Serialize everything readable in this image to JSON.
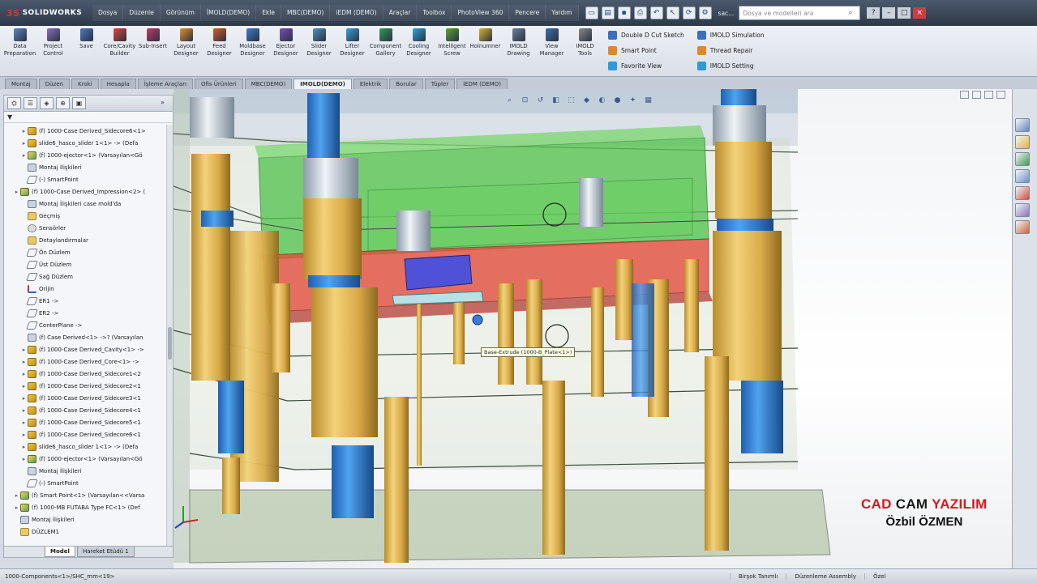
{
  "app": {
    "logo_text": "SOLIDWORKS",
    "menu": [
      "Dosya",
      "Düzenle",
      "Görünüm",
      "İMOLD(DEMO)",
      "Ekle",
      "MBC(DEMO)",
      "iEDM (DEMO)",
      "Araçlar",
      "Toolbox",
      "PhotoView 360",
      "Pencere",
      "Yardım"
    ],
    "quick_icons": [
      "new-icon",
      "open-icon",
      "save-icon",
      "print-icon",
      "undo-icon",
      "select-icon",
      "rebuild-icon",
      "options-icon"
    ],
    "search_placeholder": "Dosya ve modelleri ara",
    "window_title_fragment": "sac..."
  },
  "ribbon": {
    "buttons": [
      {
        "label": "Data\nPreparation",
        "color": "#5b86c9"
      },
      {
        "label": "Project\nControl",
        "color": "#8a6fc0"
      },
      {
        "label": "Save",
        "color": "#4a78c2"
      },
      {
        "label": "Core/Cavity\nBuilder",
        "color": "#d9463b"
      },
      {
        "label": "Sub-Insert",
        "color": "#c03b6a"
      },
      {
        "label": "Layout\nDesigner",
        "color": "#e0922b"
      },
      {
        "label": "Feed\nDesigner",
        "color": "#d45a2a"
      },
      {
        "label": "Moldbase\nDesigner",
        "color": "#3a7fc9"
      },
      {
        "label": "Ejector\nDesigner",
        "color": "#7a4fb8"
      },
      {
        "label": "Slider\nDesigner",
        "color": "#4a90c2"
      },
      {
        "label": "Lifter\nDesigner",
        "color": "#3aa0d9"
      },
      {
        "label": "Component\nGallery",
        "color": "#2f9a5a"
      },
      {
        "label": "Cooling\nDesigner",
        "color": "#2fa3d6"
      },
      {
        "label": "Intelligent\nScrew",
        "color": "#58a43a"
      },
      {
        "label": "Holnumner",
        "color": "#d9b22c"
      },
      {
        "label": "IMOLD\nDrawing",
        "color": "#6a7f98"
      },
      {
        "label": "View\nManager",
        "color": "#3a6fae"
      },
      {
        "label": "IMOLD\nTools",
        "color": "#8a8a8a"
      }
    ],
    "right_col1": [
      "Double D Cut Sketch",
      "Smart Point",
      "Favorite View"
    ],
    "right_col2": [
      "IMOLD Simulation",
      "Thread Repair",
      "IMOLD Setting"
    ]
  },
  "tabs": [
    {
      "label": "Montaj",
      "active": false
    },
    {
      "label": "Düzen",
      "active": false
    },
    {
      "label": "Kroki",
      "active": false
    },
    {
      "label": "Hesapla",
      "active": false
    },
    {
      "label": "İşleme Araçları",
      "active": false
    },
    {
      "label": "Ofis Ürünleri",
      "active": false
    },
    {
      "label": "MBC(DEMO)",
      "active": false
    },
    {
      "label": "IMOLD(DEMO)",
      "active": true
    },
    {
      "label": "Elektrik",
      "active": false
    },
    {
      "label": "Borular",
      "active": false
    },
    {
      "label": "Tüpler",
      "active": false
    },
    {
      "label": "iEDM (DEMO)",
      "active": false
    }
  ],
  "tree": {
    "filter_symbol": "▼",
    "items": [
      {
        "indent": 2,
        "icon": "part",
        "label": "(f) 1000-Case Derived_Sidecore6<1>"
      },
      {
        "indent": 2,
        "icon": "part",
        "label": "slide6_hasco_slider 1<1> -> (Defa"
      },
      {
        "indent": 2,
        "icon": "asm",
        "label": "(f) 1000-ejector<1> (Varsayılan<Gö"
      },
      {
        "indent": 2,
        "icon": "mate",
        "label": "Montaj İlişkileri"
      },
      {
        "indent": 2,
        "icon": "plane",
        "label": "(-) SmartPoint"
      },
      {
        "indent": 1,
        "icon": "asm",
        "label": "(f) 1000-Case Derived_Impression<2> ("
      },
      {
        "indent": 2,
        "icon": "mate",
        "label": "Montaj İlişkileri case mold'da"
      },
      {
        "indent": 2,
        "icon": "folder",
        "label": "Geçmiş"
      },
      {
        "indent": 2,
        "icon": "sensor",
        "label": "Sensörler"
      },
      {
        "indent": 2,
        "icon": "folder",
        "label": "Detaylandırmalar"
      },
      {
        "indent": 2,
        "icon": "plane",
        "label": "Ön Düzlem"
      },
      {
        "indent": 2,
        "icon": "plane",
        "label": "Üst Düzlem"
      },
      {
        "indent": 2,
        "icon": "plane",
        "label": "Sağ Düzlem"
      },
      {
        "indent": 2,
        "icon": "origin",
        "label": "Orijin"
      },
      {
        "indent": 2,
        "icon": "plane",
        "label": "ER1 ->"
      },
      {
        "indent": 2,
        "icon": "plane",
        "label": "ER2 ->"
      },
      {
        "indent": 2,
        "icon": "plane",
        "label": "CenterPlane ->"
      },
      {
        "indent": 2,
        "icon": "mate",
        "label": "(f) Case Derived<1> ->? (Varsayılan"
      },
      {
        "indent": 2,
        "icon": "part",
        "label": "(f) 1000-Case Derived_Cavity<1> ->"
      },
      {
        "indent": 2,
        "icon": "part",
        "label": "(f) 1000-Case Derived_Core<1> ->"
      },
      {
        "indent": 2,
        "icon": "part",
        "label": "(f) 1000-Case Derived_Sidecore1<2"
      },
      {
        "indent": 2,
        "icon": "part",
        "label": "(f) 1000-Case Derived_Sidecore2<1"
      },
      {
        "indent": 2,
        "icon": "part",
        "label": "(f) 1000-Case Derived_Sidecore3<1"
      },
      {
        "indent": 2,
        "icon": "part",
        "label": "(f) 1000-Case Derived_Sidecore4<1"
      },
      {
        "indent": 2,
        "icon": "part",
        "label": "(f) 1000-Case Derived_Sidecore5<1"
      },
      {
        "indent": 2,
        "icon": "part",
        "label": "(f) 1000-Case Derived_Sidecore6<1"
      },
      {
        "indent": 2,
        "icon": "part",
        "label": "slide6_hasco_slider 1<1> -> (Defa"
      },
      {
        "indent": 2,
        "icon": "asm",
        "label": "(f) 1000-ejector<1> (Varsayılan<Gö"
      },
      {
        "indent": 2,
        "icon": "mate",
        "label": "Montaj İlişkileri"
      },
      {
        "indent": 2,
        "icon": "plane",
        "label": "(-) SmartPoint"
      },
      {
        "indent": 1,
        "icon": "asm",
        "label": "(f) Smart Point<1> (Varsayılan<<Varsa"
      },
      {
        "indent": 1,
        "icon": "asm",
        "label": "(f) 1000-MB FUTABA Type FC<1> (Def"
      },
      {
        "indent": 1,
        "icon": "mate",
        "label": "Montaj İlişkileri"
      },
      {
        "indent": 1,
        "icon": "folder",
        "label": "DÜZLEM1"
      }
    ],
    "bottom_tabs": [
      {
        "label": "Model",
        "active": true
      },
      {
        "label": "Hareket Etüdü 1",
        "active": false
      }
    ]
  },
  "viewport": {
    "tooltip": "Base-Extrude (1000-B_Plate<1>)",
    "heads_up_icons": [
      "zoom-fit-icon",
      "zoom-area-icon",
      "previous-view-icon",
      "section-view-icon",
      "view-orientation-icon",
      "display-style-icon",
      "hide-show-icon",
      "edit-appearance-icon",
      "apply-scene-icon",
      "view-settings-icon"
    ],
    "watermark": {
      "word1": "CAD",
      "word2": "CAM",
      "word3": "YAZILIM",
      "line2": "Özbil ÖZMEN"
    }
  },
  "taskpane_icons": [
    "resources-icon",
    "design-library-icon",
    "file-explorer-icon",
    "view-palette-icon",
    "appearances-icon",
    "custom-properties-icon",
    "imold-icon"
  ],
  "status": {
    "left": "1000-Components<1>/SHC_mm<19>",
    "segments": [
      "Birşok Tanımlı",
      "Düzenleme Assembly",
      "Özel"
    ]
  }
}
